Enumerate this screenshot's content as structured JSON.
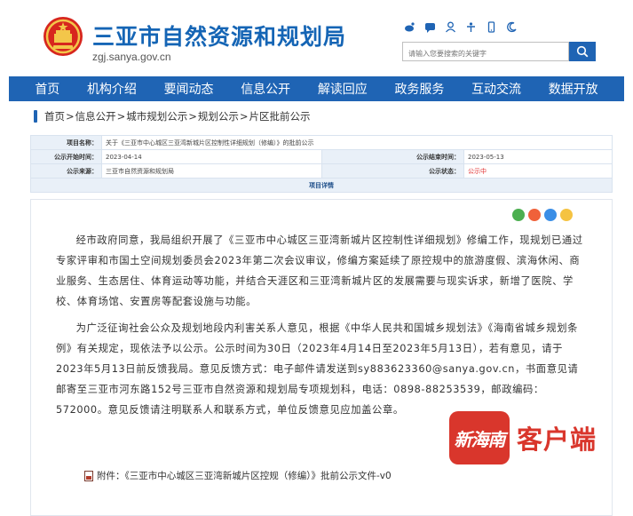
{
  "header": {
    "site_title": "三亚市自然资源和规划局",
    "domain": "zgj.sanya.gov.cn",
    "search_placeholder": "请输入您要搜索的关键字"
  },
  "nav": {
    "items": [
      "首页",
      "机构介绍",
      "要闻动态",
      "信息公开",
      "解读回应",
      "政务服务",
      "互动交流",
      "数据开放"
    ]
  },
  "breadcrumb": {
    "items": [
      "首页",
      "信息公开",
      "城市规划公示",
      "规划公示",
      "片区批前公示"
    ],
    "separator": ">"
  },
  "info": {
    "project_label": "项目名称：",
    "project_value": "关于《三亚市中心城区三亚湾新城片区控制性详细规划（修编）》的批前公示",
    "start_label": "公示开始时间：",
    "start_value": "2023-04-14",
    "end_label": "公示结束时间：",
    "end_value": "2023-05-13",
    "source_label": "公示来源：",
    "source_value": "三亚市自然资源和规划局",
    "status_label": "公示状态：",
    "status_value": "公示中",
    "detail_label": "项目详情"
  },
  "article": {
    "para1": "经市政府同意，我局组织开展了《三亚市中心城区三亚湾新城片区控制性详细规划》修编工作，现规划已通过专家评审和市国土空间规划委员会2023年第二次会议审议，修编方案延续了原控规中的旅游度假、滨海休闲、商业服务、生态居住、体育运动等功能，并结合天涯区和三亚湾新城片区的发展需要与现实诉求，新增了医院、学校、体育场馆、安置房等配套设施与功能。",
    "para2": "为广泛征询社会公众及规划地段内利害关系人意见，根据《中华人民共和国城乡规划法》《海南省城乡规划条例》有关规定，现依法予以公示。公示时间为30日（2023年4月14日至2023年5月13日），若有意见，请于2023年5月13日前反馈我局。意见反馈方式：电子邮件请发送到sy883623360@sanya.gov.cn，书面意见请邮寄至三亚市河东路152号三亚市自然资源和规划局专项规划科，电话：0898-88253539，邮政编码：572000。意见反馈请注明联系人和联系方式，单位反馈意见应加盖公章。",
    "attachment": "附件：《三亚市中心城区三亚湾新城片区控规（修编）》批前公示文件-v0"
  },
  "watermark": {
    "logo_text": "新海南",
    "label": "客户端"
  },
  "colors": {
    "brand_blue": "#1f64b4",
    "status_red": "#e03030",
    "watermark_red": "#d9362c"
  },
  "icons": {
    "top": [
      "weibo-icon",
      "wechat-icon",
      "user-icon",
      "accessibility-icon",
      "mobile-icon",
      "elder-mode-icon"
    ],
    "share": [
      "wechat-share-icon",
      "weibo-share-icon",
      "qq-share-icon",
      "favorite-share-icon"
    ]
  }
}
